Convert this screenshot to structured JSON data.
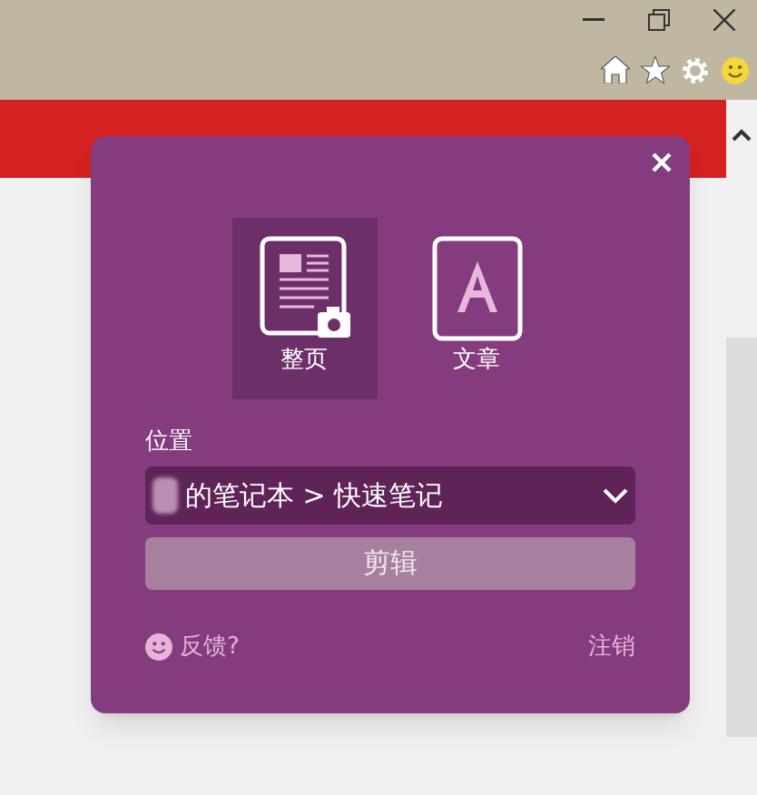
{
  "clipper": {
    "modes": [
      {
        "kind": "page",
        "label": "整页",
        "selected": true
      },
      {
        "kind": "article",
        "label": "文章",
        "selected": false
      }
    ],
    "location": {
      "label": "位置",
      "value": "的笔记本 > 快速笔记"
    },
    "clip_button": {
      "label": "剪辑",
      "disabled": true
    },
    "feedback": "反馈?",
    "sign_out": "注销"
  }
}
